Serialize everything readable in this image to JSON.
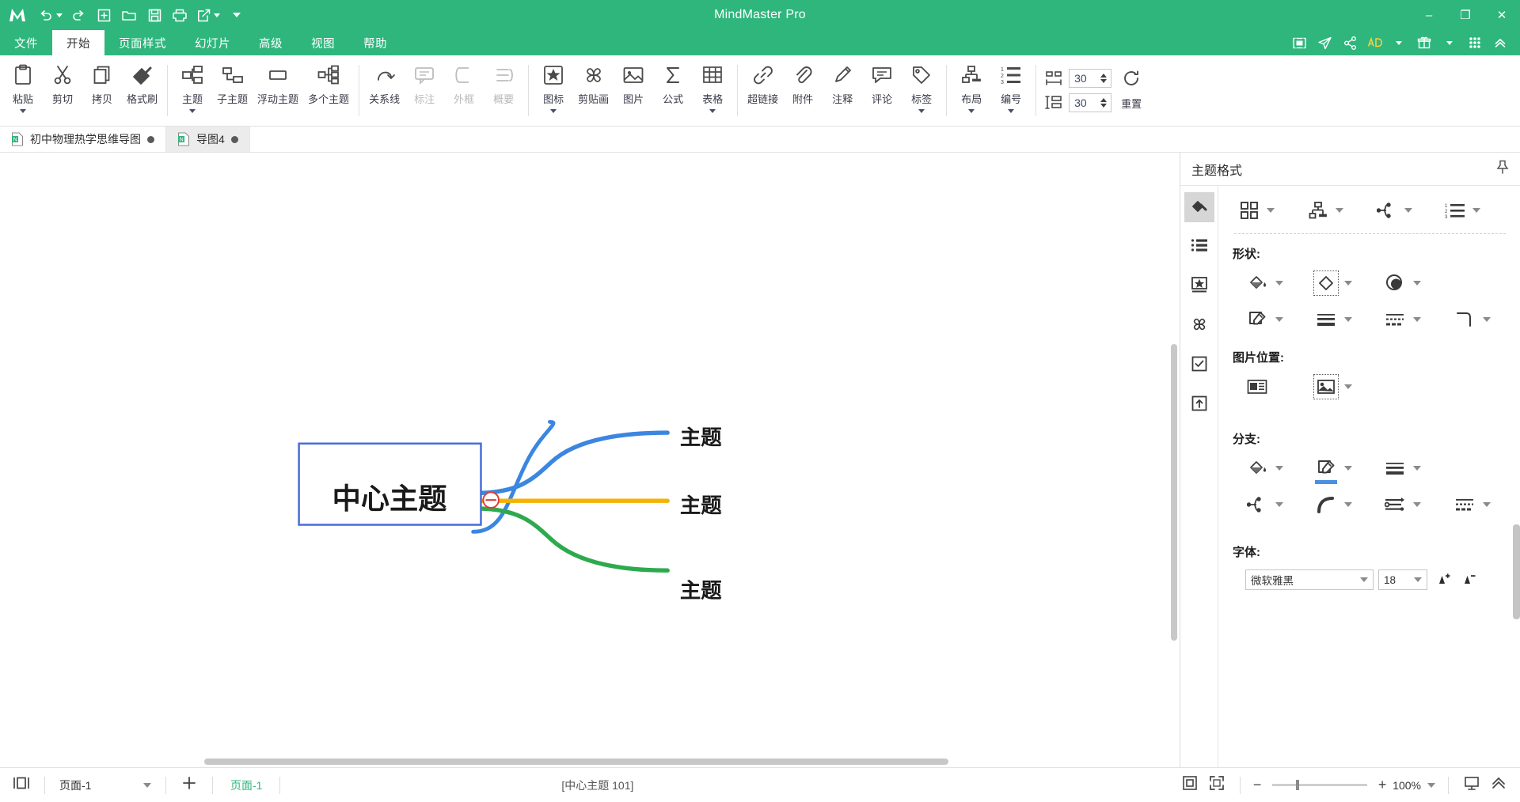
{
  "window": {
    "title": "MindMaster Pro",
    "minimize": "–",
    "maximize": "❐",
    "close": "✕"
  },
  "quick_access": [
    {
      "name": "undo",
      "icon": "undo-icon",
      "has_caret": true
    },
    {
      "name": "redo",
      "icon": "redo-icon",
      "has_caret": false
    },
    {
      "name": "new",
      "icon": "new-file-icon",
      "has_caret": false
    },
    {
      "name": "open",
      "icon": "open-folder-icon",
      "has_caret": false
    },
    {
      "name": "save",
      "icon": "save-icon",
      "has_caret": false
    },
    {
      "name": "print",
      "icon": "print-icon",
      "has_caret": false
    },
    {
      "name": "export",
      "icon": "export-icon",
      "has_caret": true
    },
    {
      "name": "more",
      "icon": "chevron-down-icon",
      "has_caret": false
    }
  ],
  "menu": {
    "items": [
      {
        "label": "文件",
        "active": false
      },
      {
        "label": "开始",
        "active": true
      },
      {
        "label": "页面样式",
        "active": false
      },
      {
        "label": "幻灯片",
        "active": false
      },
      {
        "label": "高级",
        "active": false
      },
      {
        "label": "视图",
        "active": false
      },
      {
        "label": "帮助",
        "active": false
      }
    ],
    "right_icons": [
      "presentation-icon",
      "share-send-icon",
      "share-node-icon",
      "cloud-icon",
      "gift-icon",
      "grid-apps-icon",
      "collapse-ribbon-icon"
    ],
    "ad_label": "AD"
  },
  "ribbon": {
    "groups": [
      {
        "name": "clipboard",
        "items": [
          {
            "label": "粘贴",
            "icon": "paste-icon",
            "caret": true,
            "disabled": false
          },
          {
            "label": "剪切",
            "icon": "cut-scissors-icon",
            "caret": false,
            "disabled": false
          },
          {
            "label": "拷贝",
            "icon": "copy-icon",
            "caret": false,
            "disabled": false
          },
          {
            "label": "格式刷",
            "icon": "format-painter-icon",
            "caret": false,
            "disabled": false
          }
        ]
      },
      {
        "name": "topics",
        "items": [
          {
            "label": "主题",
            "icon": "topic-icon",
            "caret": true,
            "disabled": false
          },
          {
            "label": "子主题",
            "icon": "subtopic-icon",
            "caret": false,
            "disabled": false
          },
          {
            "label": "浮动主题",
            "icon": "floating-topic-icon",
            "caret": false,
            "disabled": false
          },
          {
            "label": "多个主题",
            "icon": "multi-topic-icon",
            "caret": false,
            "disabled": false
          }
        ]
      },
      {
        "name": "relations",
        "items": [
          {
            "label": "关系线",
            "icon": "relationship-line-icon",
            "caret": false,
            "disabled": false
          },
          {
            "label": "标注",
            "icon": "callout-icon",
            "caret": false,
            "disabled": true
          },
          {
            "label": "外框",
            "icon": "boundary-icon",
            "caret": false,
            "disabled": true
          },
          {
            "label": "概要",
            "icon": "summary-icon",
            "caret": false,
            "disabled": true
          }
        ]
      },
      {
        "name": "insert",
        "items": [
          {
            "label": "图标",
            "icon": "icon-marker-icon",
            "caret": true,
            "disabled": false
          },
          {
            "label": "剪贴画",
            "icon": "clipart-icon",
            "caret": false,
            "disabled": false
          },
          {
            "label": "图片",
            "icon": "picture-icon",
            "caret": false,
            "disabled": false
          },
          {
            "label": "公式",
            "icon": "formula-sigma-icon",
            "caret": false,
            "disabled": false
          },
          {
            "label": "表格",
            "icon": "table-icon",
            "caret": true,
            "disabled": false
          }
        ]
      },
      {
        "name": "annotate",
        "items": [
          {
            "label": "超链接",
            "icon": "hyperlink-icon",
            "caret": false,
            "disabled": false
          },
          {
            "label": "附件",
            "icon": "attachment-icon",
            "caret": false,
            "disabled": false
          },
          {
            "label": "注释",
            "icon": "note-pen-icon",
            "caret": false,
            "disabled": false
          },
          {
            "label": "评论",
            "icon": "comment-icon",
            "caret": false,
            "disabled": false
          },
          {
            "label": "标签",
            "icon": "tag-icon",
            "caret": true,
            "disabled": false
          }
        ]
      },
      {
        "name": "layout",
        "items": [
          {
            "label": "布局",
            "icon": "layout-tree-icon",
            "caret": true,
            "disabled": false
          },
          {
            "label": "编号",
            "icon": "numbering-icon",
            "caret": true,
            "disabled": false
          }
        ]
      }
    ],
    "spacing": {
      "horizontal_icon": "horizontal-spacing-icon",
      "horizontal_value": "30",
      "vertical_icon": "vertical-spacing-icon",
      "vertical_value": "30",
      "reset_label": "重置",
      "reset_icon": "reset-circle-arrow-icon"
    }
  },
  "doc_tabs": [
    {
      "label": "初中物理热学思维导图",
      "active": true,
      "modified": true
    },
    {
      "label": "导图4",
      "active": false,
      "modified": true
    }
  ],
  "mindmap": {
    "center_topic": "中心主题",
    "branches": [
      {
        "label": "主题",
        "color": "#3b86e0"
      },
      {
        "label": "主题",
        "color": "#f5b301"
      },
      {
        "label": "主题",
        "color": "#2eaa4e"
      }
    ],
    "collapse_badge": "−",
    "center_border_color": "#4a6fd8"
  },
  "right_panel": {
    "title": "主题格式",
    "pin_icon": "pin-icon",
    "rail": [
      {
        "name": "style-paint-icon",
        "active": true
      },
      {
        "name": "outline-list-icon",
        "active": false
      },
      {
        "name": "icon-library-icon",
        "active": false
      },
      {
        "name": "clipart-panel-icon",
        "active": false
      },
      {
        "name": "task-checkbox-icon",
        "active": false
      },
      {
        "name": "export-up-icon",
        "active": false
      }
    ],
    "top_row": [
      {
        "name": "theme-grid-icon",
        "caret": true
      },
      {
        "name": "structure-icon",
        "caret": true
      },
      {
        "name": "branch-shape-icon",
        "caret": true
      },
      {
        "name": "numbering-panel-icon",
        "caret": true
      }
    ],
    "sections": [
      {
        "title": "形状:",
        "rows": [
          [
            {
              "name": "fill-color-icon",
              "caret": true,
              "selected": false,
              "underline": false
            },
            {
              "name": "shape-diamond-icon",
              "caret": true,
              "selected": true,
              "underline": false
            },
            {
              "name": "gradient-icon",
              "caret": true,
              "selected": false,
              "underline": false
            }
          ],
          [
            {
              "name": "border-color-icon",
              "caret": true,
              "selected": false,
              "underline": false
            },
            {
              "name": "line-weight-icon",
              "caret": true,
              "selected": false,
              "underline": false
            },
            {
              "name": "line-dash-icon",
              "caret": true,
              "selected": false,
              "underline": false
            },
            {
              "name": "corner-radius-icon",
              "caret": true,
              "selected": false,
              "underline": false
            }
          ]
        ]
      },
      {
        "title": "图片位置:",
        "rows": [
          [
            {
              "name": "image-position-left-icon",
              "caret": false,
              "selected": false,
              "underline": false
            },
            {
              "name": "image-position-picker-icon",
              "caret": true,
              "selected": true,
              "underline": false
            }
          ]
        ]
      },
      {
        "title": "分支:",
        "rows": [
          [
            {
              "name": "branch-fill-color-icon",
              "caret": true,
              "selected": false,
              "underline": false
            },
            {
              "name": "branch-line-color-icon",
              "caret": true,
              "selected": false,
              "underline": true
            },
            {
              "name": "branch-line-weight-icon",
              "caret": true,
              "selected": false,
              "underline": false
            }
          ],
          [
            {
              "name": "branch-structure-icon",
              "caret": true,
              "selected": false,
              "underline": false
            },
            {
              "name": "branch-curve-icon",
              "caret": true,
              "selected": false,
              "underline": false
            },
            {
              "name": "branch-arrow-icon",
              "caret": true,
              "selected": false,
              "underline": false
            },
            {
              "name": "branch-dash-icon",
              "caret": true,
              "selected": false,
              "underline": false
            }
          ]
        ]
      }
    ],
    "font_section": {
      "title": "字体:",
      "font_name": "微软雅黑",
      "font_size": "18",
      "increase_icon": "increase-font-icon",
      "decrease_icon": "decrease-font-icon"
    }
  },
  "status_bar": {
    "view_icon": "page-view-icon",
    "page_select_value": "页面-1",
    "add_page_icon": "plus-icon",
    "current_page_label": "页面-1",
    "selection_info": "[中心主题 101]",
    "fit_icon": "fit-page-icon",
    "fullscreen_icon": "fullscreen-icon",
    "zoom_out": "−",
    "zoom_in": "+",
    "zoom_level": "100%",
    "presentation_icon": "present-icon",
    "expand_icon": "expand-icon"
  }
}
